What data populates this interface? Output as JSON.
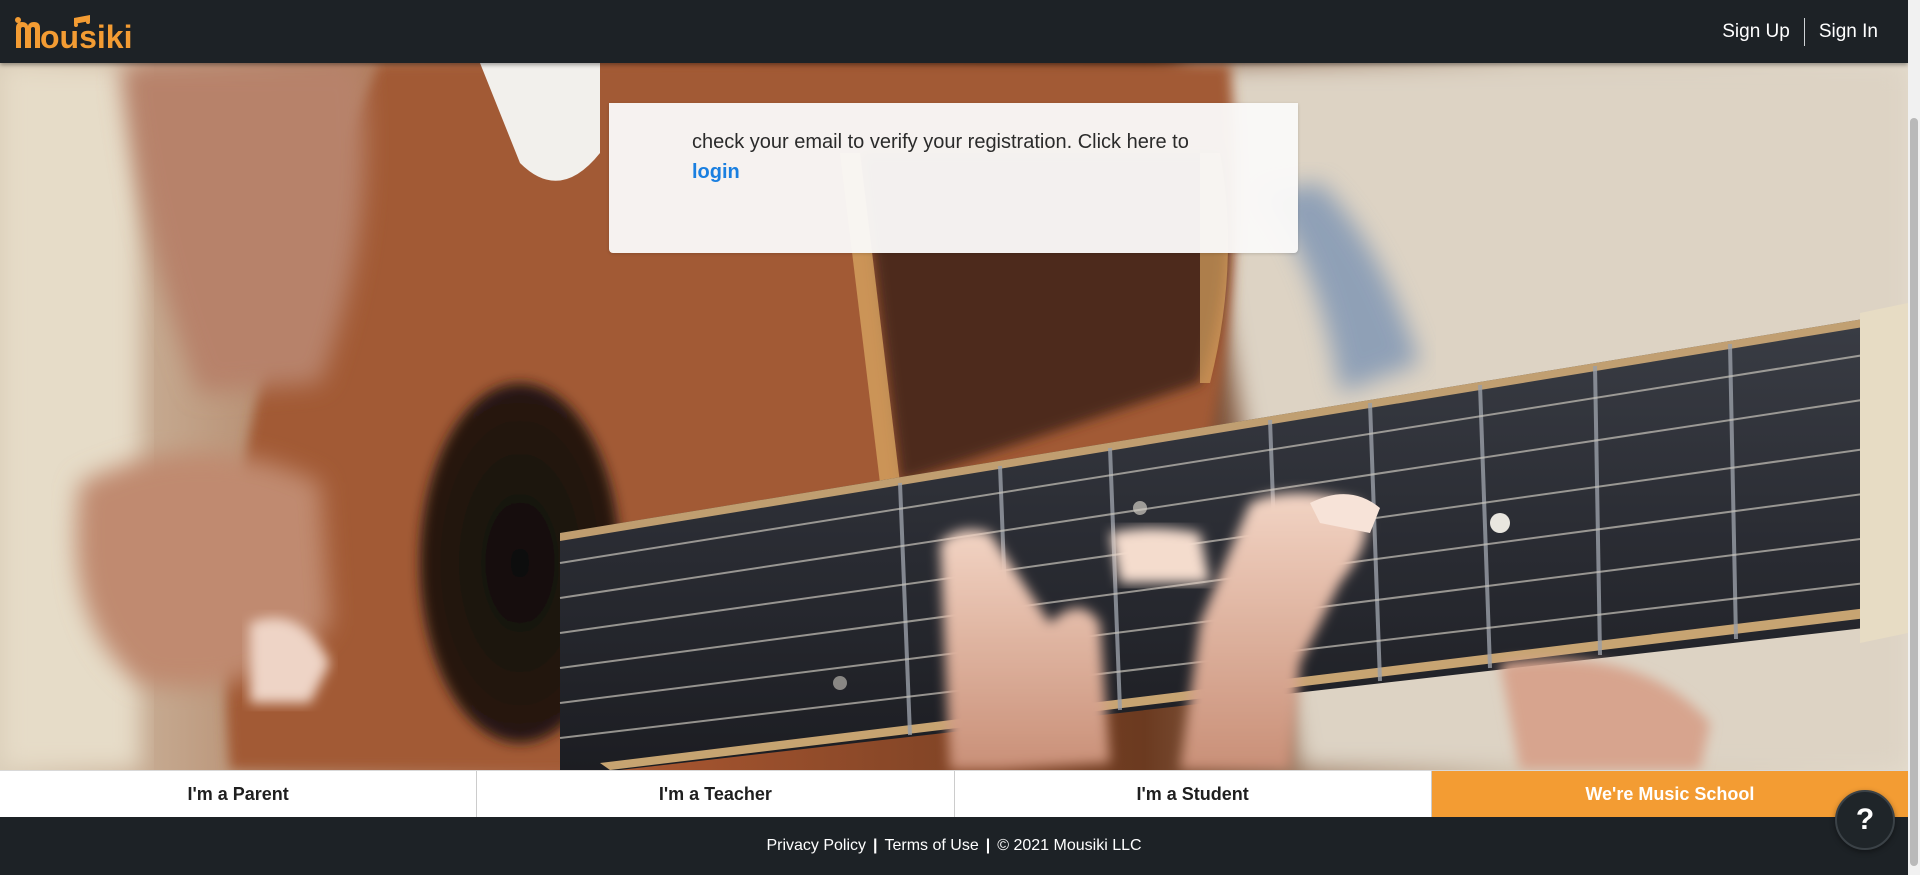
{
  "brand": {
    "logo_text": "mousiki",
    "logo_color": "#f39c33"
  },
  "nav": {
    "sign_up": "Sign Up",
    "sign_in": "Sign In"
  },
  "message": {
    "text": "check your email to verify your registration. Click here to",
    "login_link": "login"
  },
  "audience_tabs": [
    {
      "label": "I'm a Parent",
      "active": false
    },
    {
      "label": "I'm a Teacher",
      "active": false
    },
    {
      "label": "I'm a Student",
      "active": false
    },
    {
      "label": "We're Music School",
      "active": true
    }
  ],
  "footer": {
    "privacy": "Privacy Policy",
    "separator": "|",
    "terms": "Terms of Use",
    "copyright": "© 2021 Mousiki LLC"
  },
  "help": {
    "label": "?"
  },
  "colors": {
    "accent": "#f39c33",
    "header_bg": "#1d2226",
    "link_blue": "#1a7fe0"
  }
}
